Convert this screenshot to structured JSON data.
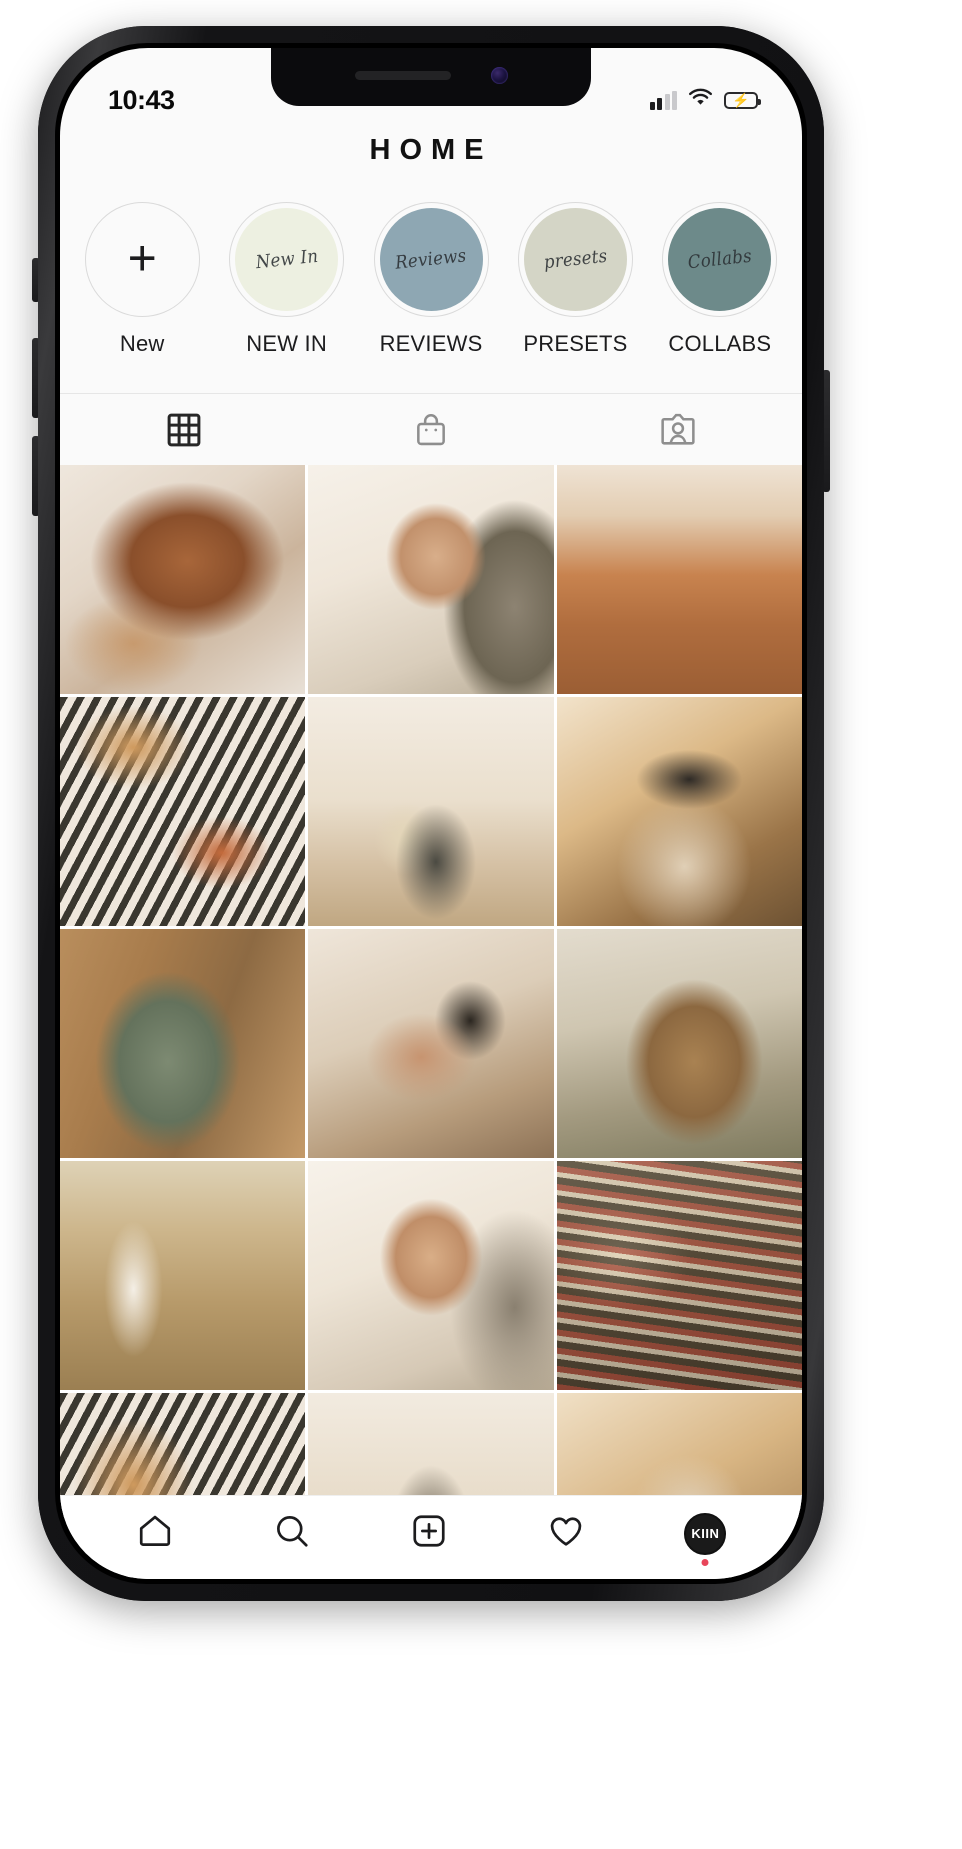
{
  "device": {
    "type": "smartphone",
    "frame_color": "#17171a"
  },
  "status_bar": {
    "time": "10:43",
    "signal_icon": "cellular-signal-icon",
    "wifi_icon": "wifi-icon",
    "battery_icon": "battery-charging-icon",
    "battery_color": "#30d158"
  },
  "header": {
    "title": "HOME"
  },
  "highlights": [
    {
      "label": "New",
      "script": "",
      "fill": "#fafafa",
      "kind": "add",
      "name": "highlight-new"
    },
    {
      "label": "NEW IN",
      "script": "New In",
      "fill": "#edf0e1",
      "kind": "story",
      "name": "highlight-new-in"
    },
    {
      "label": "REVIEWS",
      "script": "Reviews",
      "fill": "#8ea7b3",
      "kind": "story",
      "name": "highlight-reviews"
    },
    {
      "label": "PRESETS",
      "script": "presets",
      "fill": "#d4d5c6",
      "kind": "story",
      "name": "highlight-presets"
    },
    {
      "label": "COLLABS",
      "script": "Collabs",
      "fill": "#6d8a8a",
      "kind": "story",
      "name": "highlight-collabs"
    }
  ],
  "profile_tabs": [
    {
      "icon": "grid-icon",
      "label": "Grid",
      "active": true
    },
    {
      "icon": "shop-bag-icon",
      "label": "Shop",
      "active": false
    },
    {
      "icon": "tagged-icon",
      "label": "Tagged",
      "active": false
    }
  ],
  "grid": {
    "columns": 3,
    "posts": [
      {
        "alt": "Golden retriever puppy resting on knitted cream blanket",
        "art": "p-dog"
      },
      {
        "alt": "Laughing baby lying on white sheepskin blanket",
        "art": "p-baby"
      },
      {
        "alt": "Red rock canyon with winding river",
        "art": "p-canyon"
      },
      {
        "alt": "Autumn picnic flatlay with wicker basket, pumpkins and boots",
        "art": "p-pumpkin"
      },
      {
        "alt": "Couple sitting together in desert landscape",
        "art": "p-couple"
      },
      {
        "alt": "Woman in wide-brim hat in golden field",
        "art": "p-hat"
      },
      {
        "alt": "Pregnant woman in green dress holding her belly",
        "art": "p-preg"
      },
      {
        "alt": "Family lying together on a bed",
        "art": "p-bed"
      },
      {
        "alt": "Deer standing in misty meadow",
        "art": "p-deer"
      },
      {
        "alt": "Pregnant woman in white dress walking in tall grass field",
        "art": "p-field"
      },
      {
        "alt": "Laughing baby held up on sheepskin blanket",
        "art": "p-baby2"
      },
      {
        "alt": "Couple wrapped in striped blanket in dry field",
        "art": "p-blanket"
      },
      {
        "alt": "Autumn picnic flatlay with wicker basket and bread",
        "art": "p-pump2"
      },
      {
        "alt": "Couple in desert scene",
        "art": "p-couple2"
      },
      {
        "alt": "Woman in hat in warm golden light",
        "art": "p-hat2"
      }
    ]
  },
  "bottom_nav": [
    {
      "icon": "home-icon",
      "label": "Home",
      "active": true
    },
    {
      "icon": "search-icon",
      "label": "Search",
      "active": false
    },
    {
      "icon": "add-post-icon",
      "label": "New Post",
      "active": false
    },
    {
      "icon": "heart-icon",
      "label": "Activity",
      "active": false
    },
    {
      "icon": "profile-avatar",
      "label": "Profile",
      "active": false,
      "avatar_text": "KIIN",
      "badge_color": "#e8455a"
    }
  ]
}
